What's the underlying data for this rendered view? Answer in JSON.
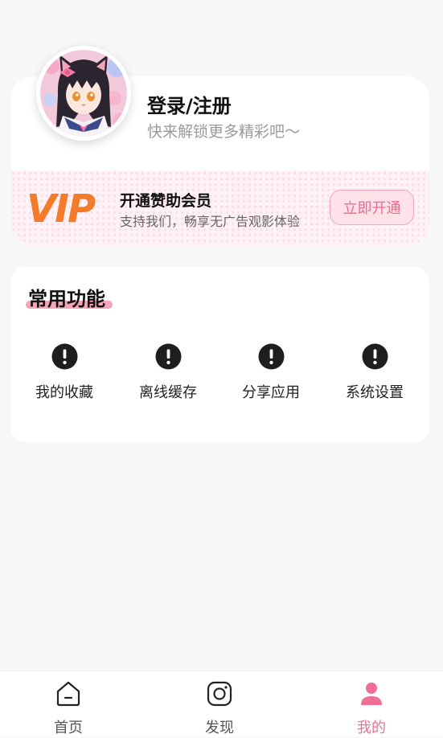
{
  "profile": {
    "login_label": "登录/注册",
    "subtitle": "快来解锁更多精彩吧～"
  },
  "vip": {
    "logo_text": "VIP",
    "title": "开通赞助会员",
    "description": "支持我们，畅享无广告观影体验",
    "button_label": "立即开通"
  },
  "functions": {
    "title": "常用功能",
    "items": [
      {
        "label": "我的收藏",
        "icon": "alert-icon"
      },
      {
        "label": "离线缓存",
        "icon": "alert-icon"
      },
      {
        "label": "分享应用",
        "icon": "alert-icon"
      },
      {
        "label": "系统设置",
        "icon": "alert-icon"
      }
    ]
  },
  "nav": {
    "items": [
      {
        "label": "首页",
        "icon": "home-icon",
        "active": false
      },
      {
        "label": "发现",
        "icon": "camera-icon",
        "active": false
      },
      {
        "label": "我的",
        "icon": "user-icon",
        "active": true
      }
    ]
  },
  "colors": {
    "accent": "#f06f95",
    "vip_orange": "#f47b2a",
    "vip_banner_bg": "#fff2f6",
    "page_bg": "#f7f7f8"
  }
}
